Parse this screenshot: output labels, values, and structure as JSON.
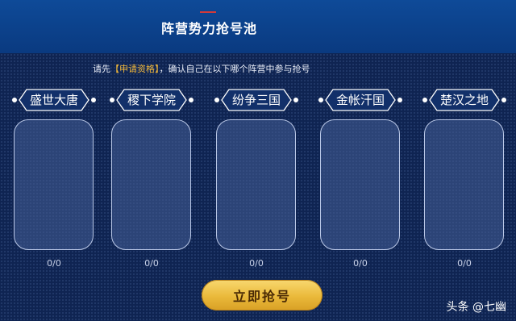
{
  "header": {
    "title": "阵营势力抢号池"
  },
  "instruction": {
    "prefix": "请先",
    "link": "【申请资格】",
    "suffix": "，确认自己在以下哪个阵营中参与抢号"
  },
  "factions": [
    {
      "name": "盛世大唐",
      "count": "0/0"
    },
    {
      "name": "稷下学院",
      "count": "0/0"
    },
    {
      "name": "纷争三国",
      "count": "0/0"
    },
    {
      "name": "金帐汗国",
      "count": "0/0"
    },
    {
      "name": "楚汉之地",
      "count": "0/0"
    }
  ],
  "action": {
    "grab_label": "立即抢号"
  },
  "watermark": "头条 @七幽",
  "colors": {
    "header_bg": "#0a3a80",
    "page_bg": "#0f2452",
    "link": "#f0b73a",
    "button_gold": "#eab93a",
    "accent_red": "#d23a3a"
  }
}
